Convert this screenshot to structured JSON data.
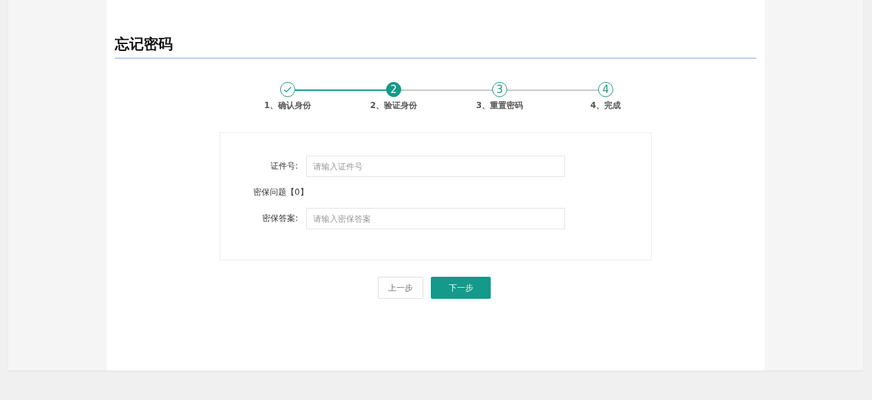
{
  "title": "忘记密码",
  "steps": [
    {
      "label": "1、确认身份",
      "completed": true,
      "selected": false
    },
    {
      "number": "2",
      "label": "2、验证身份",
      "completed": false,
      "selected": true
    },
    {
      "number": "3",
      "label": "3、重置密码",
      "completed": false,
      "selected": false
    },
    {
      "number": "4",
      "label": "4、完成",
      "completed": false,
      "selected": false
    }
  ],
  "form": [
    {
      "kind": "field",
      "label": "证件号:",
      "placeholder": "请输入证件号"
    },
    {
      "kind": "text",
      "label": "密保问题【0】"
    },
    {
      "kind": "field",
      "label": "密保答案:",
      "placeholder": "请输入密保答案"
    }
  ],
  "buttons": [
    {
      "label": "上一步",
      "primary": false
    },
    {
      "label": "下一步",
      "primary": true
    }
  ]
}
